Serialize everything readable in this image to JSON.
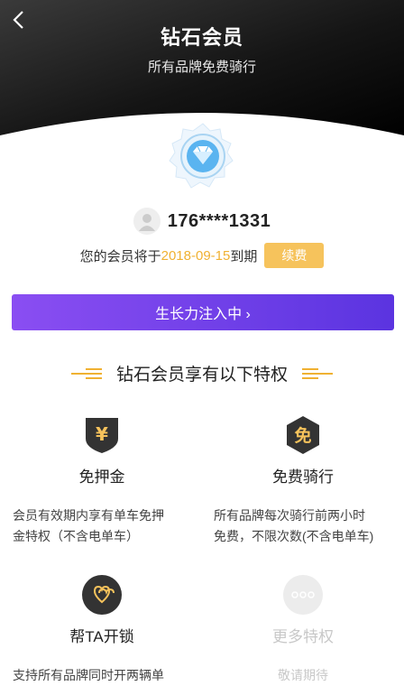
{
  "header": {
    "title": "钻石会员",
    "subtitle": "所有品牌免费骑行"
  },
  "user": {
    "phone": "176****1331"
  },
  "membership": {
    "expiry_prefix": "您的会员将于",
    "expiry_date": "2018-09-15",
    "expiry_suffix": "到期",
    "renew_label": "续费"
  },
  "growth_bar": {
    "label": "生长力注入中 ›"
  },
  "privileges": {
    "title": "钻石会员享有以下特权",
    "items": [
      {
        "name": "免押金",
        "icon_glyph": "¥",
        "description_lines": [
          "会员有效期内享有单车免押",
          "金特权（不含电单车）"
        ]
      },
      {
        "name": "免费骑行",
        "icon_glyph": "免",
        "description_lines": [
          "所有品牌每次骑行前两小时",
          "免费，不限次数(不含电单车)"
        ]
      },
      {
        "name": "帮TA开锁",
        "icon_glyph": "heart-pair",
        "description_lines": [
          "支持所有品牌同时开两辆单"
        ]
      },
      {
        "name": "更多特权",
        "icon_glyph": "more-dots",
        "description_lines": [
          "敬请期待"
        ]
      }
    ]
  },
  "colors": {
    "accent_gold": "#f0b132",
    "renew_button": "#f6c35c",
    "growth_gradient_start": "#8a4ef2",
    "growth_gradient_end": "#5b34e0",
    "icon_dark": "#2f2f2f",
    "badge_blue": "#5ab4f0"
  }
}
